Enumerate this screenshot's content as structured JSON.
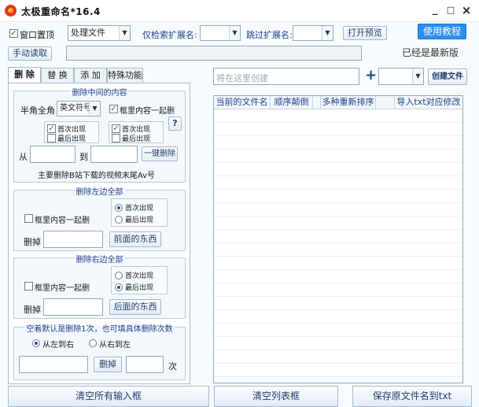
{
  "window": {
    "title": "太极重命名*16.4",
    "minimize": "_",
    "maximize": "□",
    "close": "×"
  },
  "toolbar": {
    "stay_on_top_label": "窗口置顶",
    "stay_on_top_checked": true,
    "mode_select": "处理文件",
    "ext_filter_label": "仅检索扩展名:",
    "ext_filter_value": "",
    "ext_skip_label": "跳过扩展名:",
    "ext_skip_value": "",
    "open_preview": "打开预览",
    "tutorial": "使用教程",
    "manual_read": "手动读取",
    "path_value": "",
    "version_status": "已经是最新版"
  },
  "tabs": [
    {
      "label": "删 除",
      "active": true
    },
    {
      "label": "替 换",
      "active": false
    },
    {
      "label": "添 加",
      "active": false
    },
    {
      "label": "特殊功能",
      "active": false
    }
  ],
  "delete_middle": {
    "title": "删除中间的内容",
    "halfwidth_label": "半角全角",
    "symbol_select": "英文符号",
    "with_brackets_label": "框里内容一起删",
    "with_brackets_checked": true,
    "first_a_label": "首次出现",
    "first_a_checked": true,
    "last_a_label": "最后出现",
    "last_a_checked": false,
    "first_b_label": "首次出现",
    "first_b_checked": true,
    "last_b_label": "最后出现",
    "last_b_checked": false,
    "help": "?",
    "from_label": "从",
    "to_label": "到",
    "from_value": "",
    "to_value": "",
    "one_click_delete": "一键删除",
    "note": "主要删除B站下载的视频末尾Av号"
  },
  "delete_left": {
    "title": "删除左边全部",
    "with_brackets_label": "框里内容一起删",
    "with_brackets_checked": false,
    "first_label": "首次出现",
    "last_label": "最后出现",
    "selected": "first",
    "delete_label": "删掉",
    "value": "",
    "action": "前面的东西"
  },
  "delete_right": {
    "title": "删除右边全部",
    "with_brackets_label": "框里内容一起删",
    "with_brackets_checked": false,
    "first_label": "首次出现",
    "last_label": "最后出现",
    "selected": "last",
    "delete_label": "删掉",
    "value": "",
    "action": "后面的东西"
  },
  "delete_count": {
    "title": "空着默认是删除1次，也可填具体删除次数",
    "left_to_right": "从左到右",
    "right_to_left": "从右到左",
    "selected": "left_to_right",
    "text_value": "",
    "delete_button": "删掉",
    "count_value": "",
    "times_label": "次"
  },
  "create": {
    "placeholder": "将在这里创建",
    "plus": "+",
    "select_value": "",
    "button": "创建文件"
  },
  "list": {
    "columns": [
      "当前的文件名",
      "顺序颠倒",
      "多种重新排序",
      "导入txt对应修改"
    ],
    "rows": []
  },
  "bottom": {
    "clear_inputs": "清空所有输入框",
    "clear_list": "清空列表框",
    "save_names": "保存原文件名到txt"
  }
}
